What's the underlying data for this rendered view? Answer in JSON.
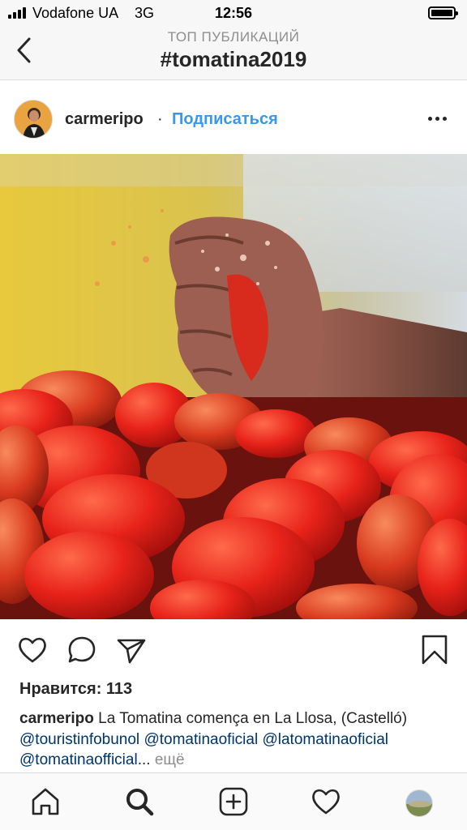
{
  "status_bar": {
    "carrier": "Vodafone UA",
    "network": "3G",
    "time": "12:56"
  },
  "header": {
    "subtitle": "ТОП ПУБЛИКАЦИЙ",
    "title": "#tomatina2019"
  },
  "post": {
    "username": "carmeripo",
    "separator": "·",
    "follow_label": "Подписаться",
    "likes_text": "Нравится: 113",
    "caption": {
      "username": "carmeripo",
      "text": " La Tomatina comença en La Llosa, (Castelló) ",
      "mentions": [
        "@touristinfobunol",
        "@tomatinaoficial",
        "@latomatinaoficial",
        "@tomatinaofficial"
      ],
      "ellipsis": "...",
      "more_label": "ещё"
    }
  },
  "colors": {
    "accent_blue": "#3897f0",
    "mention_blue": "#003569",
    "text": "#262626",
    "muted": "#8e8e8e"
  },
  "icons": {
    "back": "chevron-left-icon",
    "more": "ellipsis-icon",
    "like": "heart-icon",
    "comment": "comment-icon",
    "share": "paper-plane-icon",
    "save": "bookmark-icon",
    "home": "home-icon",
    "search": "search-icon",
    "new_post": "plus-square-icon",
    "activity": "heart-icon",
    "profile": "profile-avatar"
  }
}
